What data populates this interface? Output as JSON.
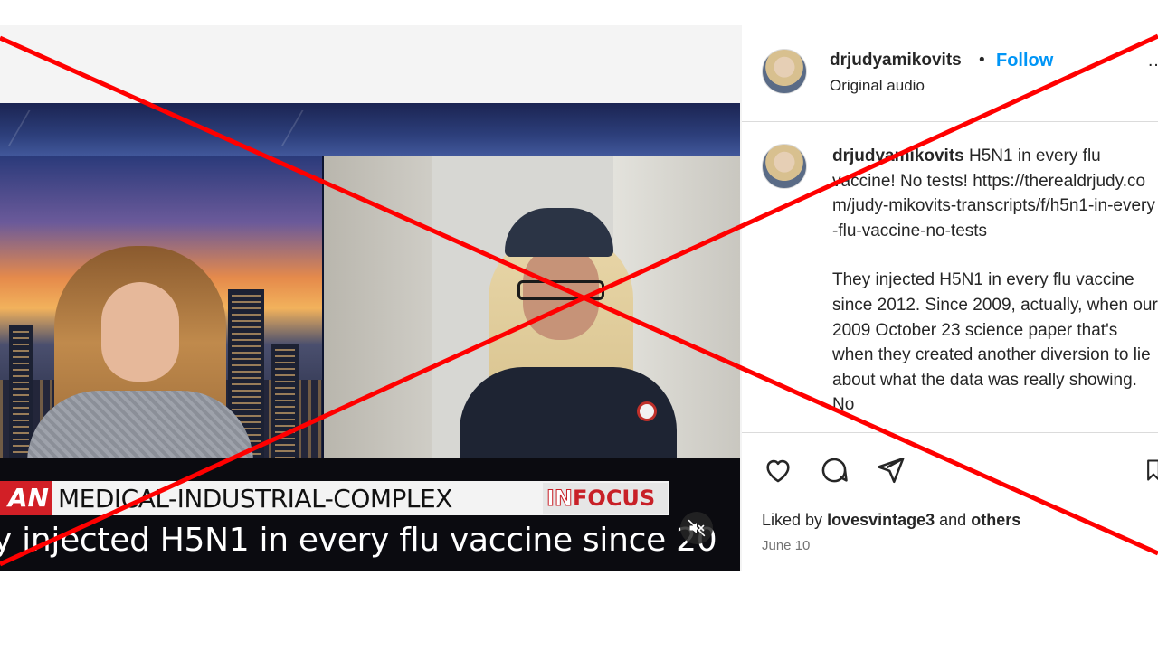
{
  "post": {
    "username": "drjudyamikovits",
    "separator": "•",
    "follow_label": "Follow",
    "audio_label": "Original audio",
    "caption_user": "drjudyamikovits",
    "caption_line1": "H5N1 in every flu vaccine! No tests!",
    "caption_link": "https://therealdrjudy.com/judy-mikovits-transcripts/f/h5n1-in-every-flu-vaccine-no-tests",
    "caption_body": "They injected H5N1 in every flu vaccine since 2012. Since 2009, actually, when our 2009 October 23 science paper that's when they created another diversion to lie about what the data was really showing. No",
    "liked_by_prefix": "Liked by",
    "liked_by_user": "lovesvintage3",
    "liked_by_suffix": "and",
    "liked_by_others": "others",
    "date": "June 10"
  },
  "video": {
    "brand_text": "AN",
    "headline": "MEDICAL-INDUSTRIAL-COMPLEX",
    "infocus_in": "IN",
    "infocus_focus": "FOCUS",
    "ticker": "y injected H5N1 in every flu vaccine since 20"
  },
  "icons": {
    "heart": "heart-icon",
    "comment": "comment-icon",
    "share": "share-icon",
    "save": "bookmark-icon",
    "mute": "speaker-muted-icon",
    "more": "more-options-icon"
  },
  "colors": {
    "follow_blue": "#0095f6",
    "cross_red": "#ff0000",
    "chyron_red": "#d21f26"
  }
}
